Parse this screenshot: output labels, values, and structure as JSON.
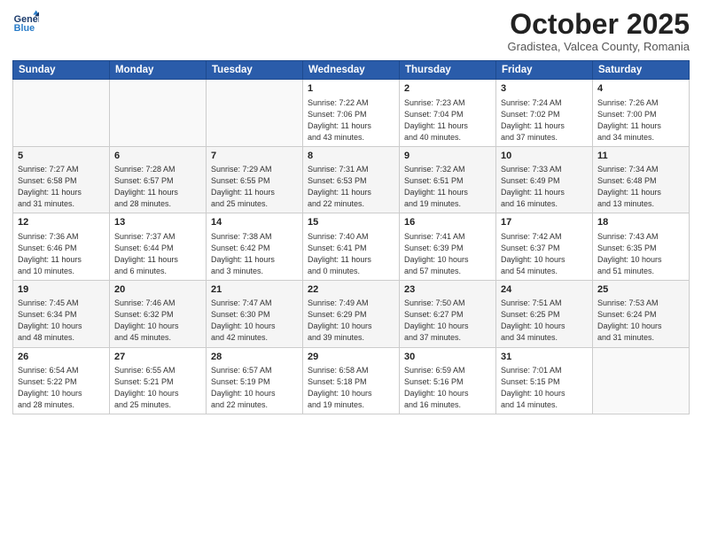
{
  "header": {
    "logo_line1": "General",
    "logo_line2": "Blue",
    "month": "October 2025",
    "location": "Gradistea, Valcea County, Romania"
  },
  "weekdays": [
    "Sunday",
    "Monday",
    "Tuesday",
    "Wednesday",
    "Thursday",
    "Friday",
    "Saturday"
  ],
  "weeks": [
    [
      {
        "day": "",
        "info": ""
      },
      {
        "day": "",
        "info": ""
      },
      {
        "day": "",
        "info": ""
      },
      {
        "day": "1",
        "info": "Sunrise: 7:22 AM\nSunset: 7:06 PM\nDaylight: 11 hours\nand 43 minutes."
      },
      {
        "day": "2",
        "info": "Sunrise: 7:23 AM\nSunset: 7:04 PM\nDaylight: 11 hours\nand 40 minutes."
      },
      {
        "day": "3",
        "info": "Sunrise: 7:24 AM\nSunset: 7:02 PM\nDaylight: 11 hours\nand 37 minutes."
      },
      {
        "day": "4",
        "info": "Sunrise: 7:26 AM\nSunset: 7:00 PM\nDaylight: 11 hours\nand 34 minutes."
      }
    ],
    [
      {
        "day": "5",
        "info": "Sunrise: 7:27 AM\nSunset: 6:58 PM\nDaylight: 11 hours\nand 31 minutes."
      },
      {
        "day": "6",
        "info": "Sunrise: 7:28 AM\nSunset: 6:57 PM\nDaylight: 11 hours\nand 28 minutes."
      },
      {
        "day": "7",
        "info": "Sunrise: 7:29 AM\nSunset: 6:55 PM\nDaylight: 11 hours\nand 25 minutes."
      },
      {
        "day": "8",
        "info": "Sunrise: 7:31 AM\nSunset: 6:53 PM\nDaylight: 11 hours\nand 22 minutes."
      },
      {
        "day": "9",
        "info": "Sunrise: 7:32 AM\nSunset: 6:51 PM\nDaylight: 11 hours\nand 19 minutes."
      },
      {
        "day": "10",
        "info": "Sunrise: 7:33 AM\nSunset: 6:49 PM\nDaylight: 11 hours\nand 16 minutes."
      },
      {
        "day": "11",
        "info": "Sunrise: 7:34 AM\nSunset: 6:48 PM\nDaylight: 11 hours\nand 13 minutes."
      }
    ],
    [
      {
        "day": "12",
        "info": "Sunrise: 7:36 AM\nSunset: 6:46 PM\nDaylight: 11 hours\nand 10 minutes."
      },
      {
        "day": "13",
        "info": "Sunrise: 7:37 AM\nSunset: 6:44 PM\nDaylight: 11 hours\nand 6 minutes."
      },
      {
        "day": "14",
        "info": "Sunrise: 7:38 AM\nSunset: 6:42 PM\nDaylight: 11 hours\nand 3 minutes."
      },
      {
        "day": "15",
        "info": "Sunrise: 7:40 AM\nSunset: 6:41 PM\nDaylight: 11 hours\nand 0 minutes."
      },
      {
        "day": "16",
        "info": "Sunrise: 7:41 AM\nSunset: 6:39 PM\nDaylight: 10 hours\nand 57 minutes."
      },
      {
        "day": "17",
        "info": "Sunrise: 7:42 AM\nSunset: 6:37 PM\nDaylight: 10 hours\nand 54 minutes."
      },
      {
        "day": "18",
        "info": "Sunrise: 7:43 AM\nSunset: 6:35 PM\nDaylight: 10 hours\nand 51 minutes."
      }
    ],
    [
      {
        "day": "19",
        "info": "Sunrise: 7:45 AM\nSunset: 6:34 PM\nDaylight: 10 hours\nand 48 minutes."
      },
      {
        "day": "20",
        "info": "Sunrise: 7:46 AM\nSunset: 6:32 PM\nDaylight: 10 hours\nand 45 minutes."
      },
      {
        "day": "21",
        "info": "Sunrise: 7:47 AM\nSunset: 6:30 PM\nDaylight: 10 hours\nand 42 minutes."
      },
      {
        "day": "22",
        "info": "Sunrise: 7:49 AM\nSunset: 6:29 PM\nDaylight: 10 hours\nand 39 minutes."
      },
      {
        "day": "23",
        "info": "Sunrise: 7:50 AM\nSunset: 6:27 PM\nDaylight: 10 hours\nand 37 minutes."
      },
      {
        "day": "24",
        "info": "Sunrise: 7:51 AM\nSunset: 6:25 PM\nDaylight: 10 hours\nand 34 minutes."
      },
      {
        "day": "25",
        "info": "Sunrise: 7:53 AM\nSunset: 6:24 PM\nDaylight: 10 hours\nand 31 minutes."
      }
    ],
    [
      {
        "day": "26",
        "info": "Sunrise: 6:54 AM\nSunset: 5:22 PM\nDaylight: 10 hours\nand 28 minutes."
      },
      {
        "day": "27",
        "info": "Sunrise: 6:55 AM\nSunset: 5:21 PM\nDaylight: 10 hours\nand 25 minutes."
      },
      {
        "day": "28",
        "info": "Sunrise: 6:57 AM\nSunset: 5:19 PM\nDaylight: 10 hours\nand 22 minutes."
      },
      {
        "day": "29",
        "info": "Sunrise: 6:58 AM\nSunset: 5:18 PM\nDaylight: 10 hours\nand 19 minutes."
      },
      {
        "day": "30",
        "info": "Sunrise: 6:59 AM\nSunset: 5:16 PM\nDaylight: 10 hours\nand 16 minutes."
      },
      {
        "day": "31",
        "info": "Sunrise: 7:01 AM\nSunset: 5:15 PM\nDaylight: 10 hours\nand 14 minutes."
      },
      {
        "day": "",
        "info": ""
      }
    ]
  ]
}
